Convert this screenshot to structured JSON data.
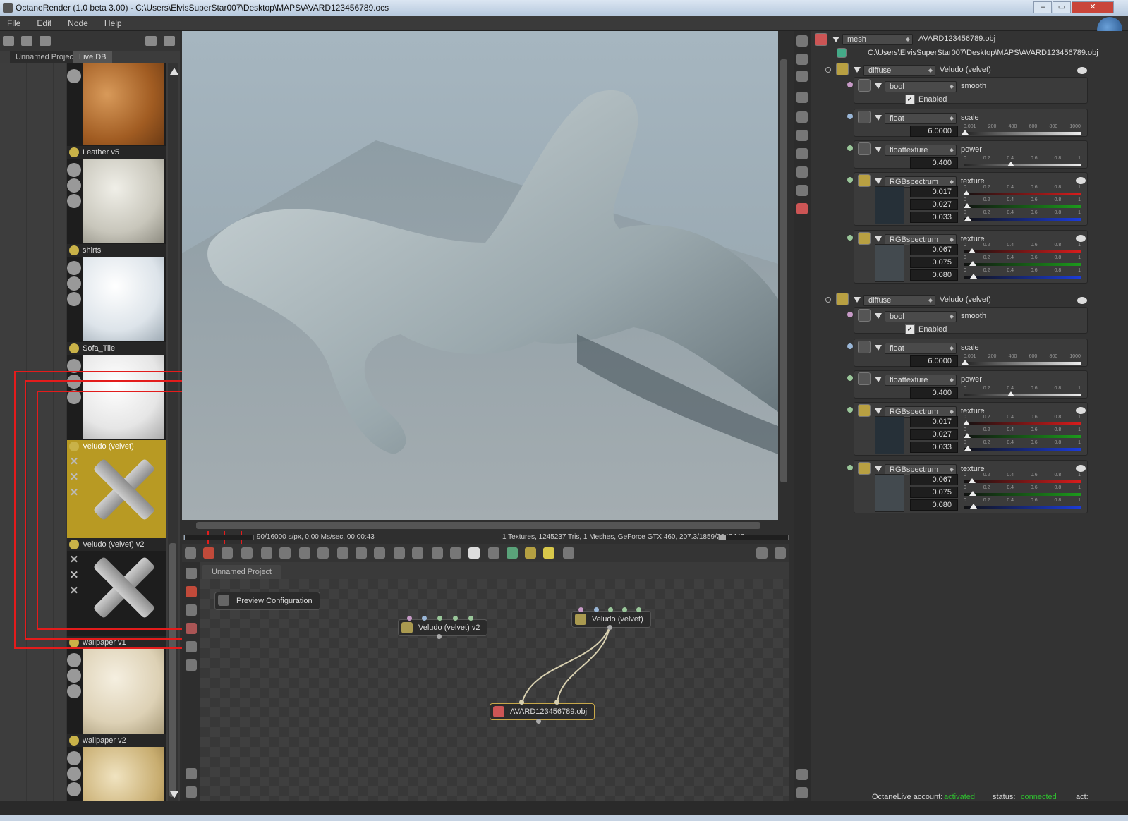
{
  "window": {
    "title": "OctaneRender (1.0 beta 3.00) - C:\\Users\\ElvisSuperStar007\\Desktop\\MAPS\\AVARD123456789.ocs",
    "controls": [
      "–",
      "▭",
      "✕"
    ]
  },
  "menu": [
    "File",
    "Edit",
    "Node",
    "Help"
  ],
  "left_panel": {
    "tabs": [
      "Unnamed Project",
      "Live DB"
    ],
    "materials": [
      {
        "name": ""
      },
      {
        "name": "Leather v5"
      },
      {
        "name": "shirts"
      },
      {
        "name": "Sofa_Tile"
      },
      {
        "name": "Veludo (velvet)",
        "selected": true
      },
      {
        "name": "Veludo (velvet) v2"
      },
      {
        "name": "wallpaper v1"
      },
      {
        "name": "wallpaper v2"
      }
    ]
  },
  "viewport": {
    "status_left": "90/16000 s/px, 0.00 Ms/sec, 00:00:43",
    "status_right": "1 Textures, 1245237 Tris, 1 Meshes, GeForce GTX 460, 207.3/1859/2047 MB",
    "progress": 0.005625
  },
  "node_graph": {
    "tab": "Unnamed Project",
    "preview_button": "Preview Configuration",
    "nodes": {
      "velvet_v2": "Veludo (velvet) v2",
      "velvet": "Veludo (velvet)",
      "mesh": "AVARD123456789.obj"
    }
  },
  "inspector": {
    "mesh_type": "mesh",
    "mesh_name": "AVARD123456789.obj",
    "mesh_path": "C:\\Users\\ElvisSuperStar007\\Desktop\\MAPS\\AVARD123456789.obj",
    "materials": [
      {
        "type": "diffuse",
        "name": "Veludo (velvet)",
        "bool": {
          "type": "bool",
          "label": "smooth",
          "checkbox": "Enabled",
          "checked": true
        },
        "float": {
          "type": "float",
          "label": "scale",
          "value": "6.0000",
          "ticks": [
            "0.001",
            "200",
            "400",
            "600",
            "800",
            "1000"
          ],
          "level": 0.006
        },
        "floattexture": {
          "type": "floattexture",
          "label": "power",
          "value": "0.400",
          "ticks": [
            "0",
            "0.2",
            "0.4",
            "0.6",
            "0.8",
            "1"
          ],
          "level": 0.4
        },
        "spectra": [
          {
            "type": "RGBspectrum",
            "label": "texture",
            "values": [
              "0.017",
              "0.027",
              "0.033"
            ],
            "swatch": "#263038"
          },
          {
            "type": "RGBspectrum",
            "label": "texture",
            "values": [
              "0.067",
              "0.075",
              "0.080"
            ],
            "swatch": "#434a4f"
          }
        ]
      },
      {
        "type": "diffuse",
        "name": "Veludo (velvet)",
        "bool": {
          "type": "bool",
          "label": "smooth",
          "checkbox": "Enabled",
          "checked": true
        },
        "float": {
          "type": "float",
          "label": "scale",
          "value": "6.0000",
          "ticks": [
            "0.001",
            "200",
            "400",
            "600",
            "800",
            "1000"
          ],
          "level": 0.006
        },
        "floattexture": {
          "type": "floattexture",
          "label": "power",
          "value": "0.400",
          "ticks": [
            "0",
            "0.2",
            "0.4",
            "0.6",
            "0.8",
            "1"
          ],
          "level": 0.4
        },
        "spectra": [
          {
            "type": "RGBspectrum",
            "label": "texture",
            "values": [
              "0.017",
              "0.027",
              "0.033"
            ],
            "swatch": "#263038"
          },
          {
            "type": "RGBspectrum",
            "label": "texture",
            "values": [
              "0.067",
              "0.075",
              "0.080"
            ],
            "swatch": "#434a4f"
          }
        ]
      }
    ],
    "spectrum_ticks": [
      "0",
      "0.2",
      "0.4",
      "0.6",
      "0.8",
      "1"
    ]
  },
  "statusbar": {
    "account_label": "OctaneLive account:",
    "account_value": "activated",
    "status_label": "status:",
    "status_value": "connected",
    "act_label": "act:"
  },
  "colors": {
    "accent_green": "#2fbf2f",
    "selected_material": "#b89a23",
    "highlight_box": "#e31c1c"
  }
}
